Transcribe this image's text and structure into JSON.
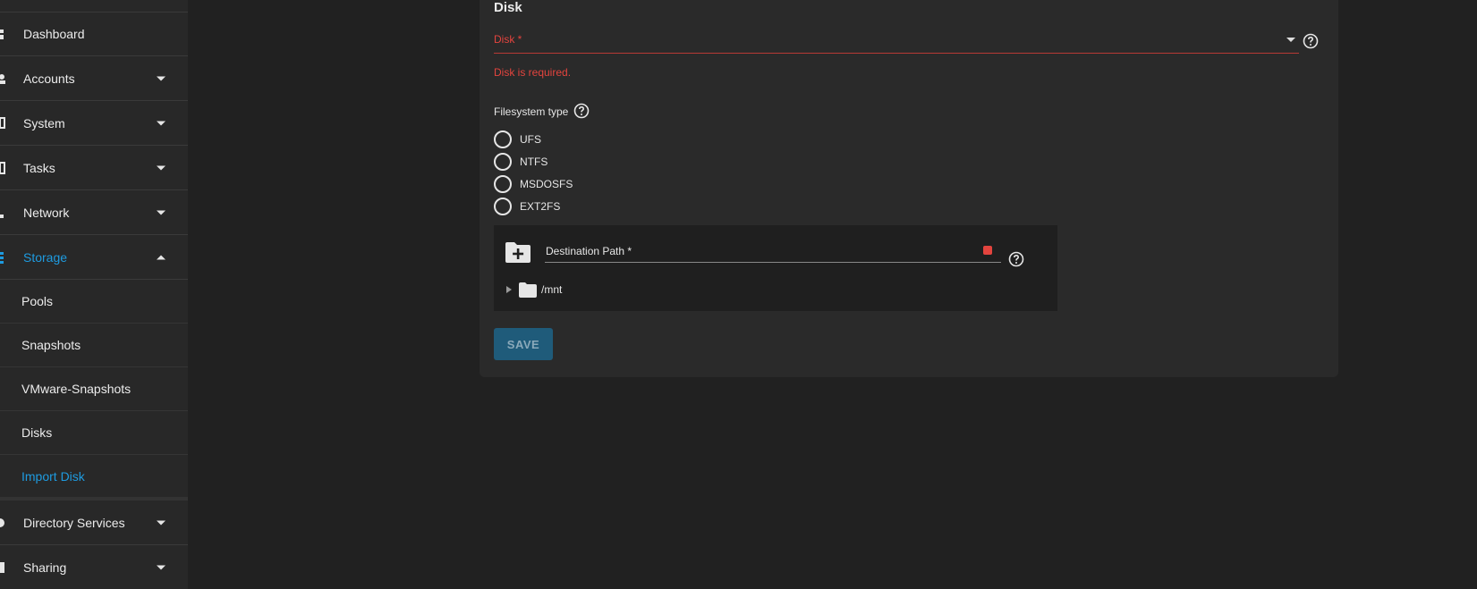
{
  "sidebar": {
    "items": [
      {
        "label": "Dashboard",
        "icon": "dashboard-icon",
        "has_caret": false
      },
      {
        "label": "Accounts",
        "icon": "accounts-icon",
        "has_caret": true
      },
      {
        "label": "System",
        "icon": "system-icon",
        "has_caret": true
      },
      {
        "label": "Tasks",
        "icon": "tasks-icon",
        "has_caret": true
      },
      {
        "label": "Network",
        "icon": "network-icon",
        "has_caret": true
      },
      {
        "label": "Storage",
        "icon": "storage-icon",
        "has_caret": true,
        "expanded": true,
        "active": true
      },
      {
        "label": "Directory Services",
        "icon": "directory-services-icon",
        "has_caret": true
      },
      {
        "label": "Sharing",
        "icon": "sharing-icon",
        "has_caret": true
      }
    ],
    "storage_subitems": [
      {
        "label": "Pools"
      },
      {
        "label": "Snapshots"
      },
      {
        "label": "VMware-Snapshots"
      },
      {
        "label": "Disks"
      },
      {
        "label": "Import Disk",
        "active": true
      }
    ]
  },
  "form": {
    "section_title": "Disk",
    "disk_label": "Disk *",
    "disk_error": "Disk is required.",
    "fs_type_label": "Filesystem type",
    "fs_options": [
      "UFS",
      "NTFS",
      "MSDOSFS",
      "EXT2FS"
    ],
    "destination_label": "Destination Path *",
    "tree_root": "/mnt",
    "save_label": "SAVE"
  },
  "colors": {
    "background": "#212121",
    "sidebar": "#282828",
    "card": "#2a2a2a",
    "accent": "#1e9be0",
    "error": "#e3443e",
    "save_button": "#1f5b7a"
  }
}
